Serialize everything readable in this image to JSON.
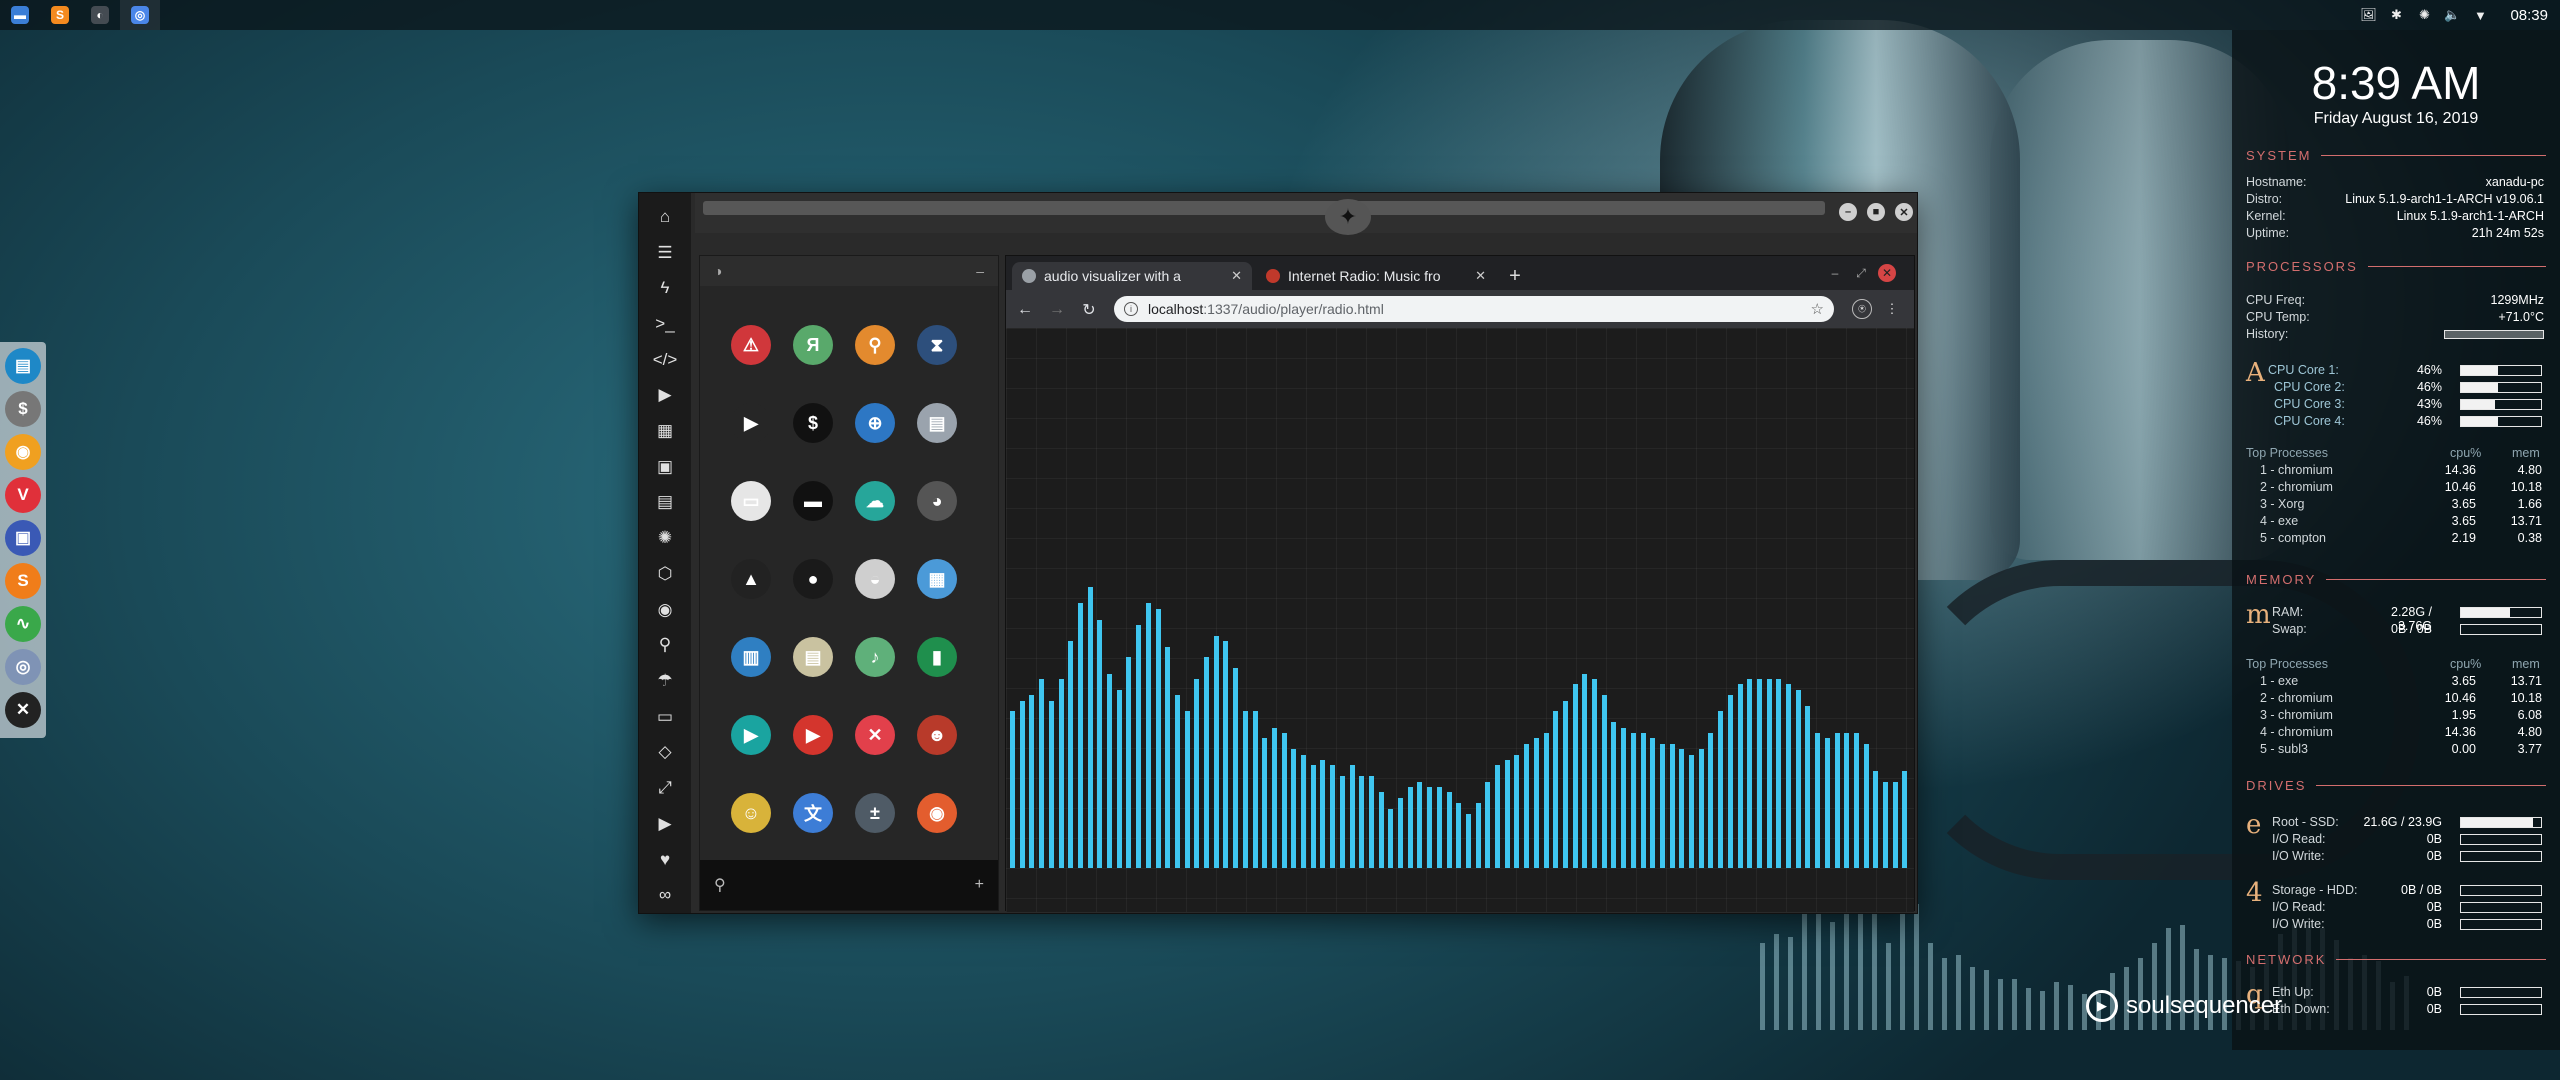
{
  "top_panel": {
    "apps": [
      {
        "name": "file-manager-icon",
        "glyph": "▬",
        "color": "#3b7ed6"
      },
      {
        "name": "sublime-icon",
        "glyph": "S",
        "color": "#f48a1f"
      },
      {
        "name": "moon-icon",
        "glyph": "◐",
        "color": "#444b52"
      },
      {
        "name": "chromium-icon",
        "glyph": "◎",
        "color": "#4a86e8"
      }
    ],
    "tray": [
      "🖼",
      "✱",
      "✺",
      "🔈",
      "▼"
    ],
    "clock": "08:39"
  },
  "dock": [
    {
      "name": "files-dock-icon",
      "glyph": "▤",
      "color": "#1e88c7"
    },
    {
      "name": "money-dock-icon",
      "glyph": "$",
      "color": "#777"
    },
    {
      "name": "ubuntu-dock-icon",
      "glyph": "◉",
      "color": "#f0a020"
    },
    {
      "name": "vivaldi-dock-icon",
      "glyph": "V",
      "color": "#e0303a"
    },
    {
      "name": "screen-dock-icon",
      "glyph": "▣",
      "color": "#3a59b5"
    },
    {
      "name": "sublime-dock-icon",
      "glyph": "S",
      "color": "#f07d1a"
    },
    {
      "name": "monitor-dock-icon",
      "glyph": "∿",
      "color": "#3aa84a"
    },
    {
      "name": "chromium-dock-icon",
      "glyph": "◎",
      "color": "#7f93b5"
    },
    {
      "name": "xbox-dock-icon",
      "glyph": "✕",
      "color": "#222"
    }
  ],
  "rail": [
    "⌂",
    "☰",
    "ϟ",
    ">_",
    "</>",
    "▶",
    "▦",
    "▣",
    "▤",
    "✺",
    "⬡",
    "◉",
    "⚲",
    "☂",
    "▭",
    "◇",
    "⤢",
    "▶",
    "♥",
    "∞"
  ],
  "rail_names": [
    "home-icon",
    "document-icon",
    "bolt-icon",
    "terminal-icon",
    "code-icon",
    "play-icon",
    "box-icon",
    "image-icon",
    "news-icon",
    "gear-icon",
    "hex-icon",
    "globe-icon",
    "search-icon",
    "umbrella-icon",
    "contact-icon",
    "diamond-icon",
    "expand-icon",
    "youtube-icon",
    "heart-icon",
    "infinity-icon"
  ],
  "launcher": {
    "header_icon": "◑",
    "header_action": "–",
    "search_icon": "⚲",
    "add_icon": "+",
    "apps": [
      {
        "name": "warning-app-icon",
        "glyph": "⚠",
        "color": "#d0373b"
      },
      {
        "name": "yandex-app-icon",
        "glyph": "Я",
        "color": "#59a96b"
      },
      {
        "name": "search-app-icon",
        "glyph": "⚲",
        "color": "#e38a2e"
      },
      {
        "name": "hourglass-app-icon",
        "glyph": "⧗",
        "color": "#2d4f7c"
      },
      {
        "name": "sublime-app-icon",
        "glyph": "▶",
        "color": "#262626"
      },
      {
        "name": "terminal-app-icon",
        "glyph": "$",
        "color": "#111"
      },
      {
        "name": "globe-app-icon",
        "glyph": "⊕",
        "color": "#2d77c4"
      },
      {
        "name": "disk-app-icon",
        "glyph": "▤",
        "color": "#9aa3ad"
      },
      {
        "name": "window-app-icon",
        "glyph": "▭",
        "color": "#e6e6e6"
      },
      {
        "name": "drive-app-icon",
        "glyph": "▬",
        "color": "#111"
      },
      {
        "name": "cloud-app-icon",
        "glyph": "☁",
        "color": "#26a69a"
      },
      {
        "name": "github-app-icon",
        "glyph": "◕",
        "color": "#555"
      },
      {
        "name": "startrek-app-icon",
        "glyph": "▲",
        "color": "#222"
      },
      {
        "name": "deathstar-app-icon",
        "glyph": "●",
        "color": "#1a1a1a"
      },
      {
        "name": "moon-app-icon",
        "glyph": "◒",
        "color": "#cfcfcf"
      },
      {
        "name": "maps-app-icon",
        "glyph": "▦",
        "color": "#4b9ad8"
      },
      {
        "name": "books-app-icon",
        "glyph": "▥",
        "color": "#2f7fc2"
      },
      {
        "name": "notes-app-icon",
        "glyph": "▤",
        "color": "#c9c2a0"
      },
      {
        "name": "music-app-icon",
        "glyph": "♪",
        "color": "#5fb07a"
      },
      {
        "name": "film-app-icon",
        "glyph": "▮",
        "color": "#1f8f4d"
      },
      {
        "name": "play-app-icon",
        "glyph": "▶",
        "color": "#1aa4a0"
      },
      {
        "name": "youtube-app-icon",
        "glyph": "▶",
        "color": "#d4352d"
      },
      {
        "name": "close-app-icon",
        "glyph": "✕",
        "color": "#e2404b"
      },
      {
        "name": "ironman-app-icon",
        "glyph": "☻",
        "color": "#b83a2a"
      },
      {
        "name": "c3po-app-icon",
        "glyph": "☺",
        "color": "#d8b33a"
      },
      {
        "name": "translate-app-icon",
        "glyph": "文",
        "color": "#3d7dd6"
      },
      {
        "name": "calculator-app-icon",
        "glyph": "±",
        "color": "#4f5b66"
      },
      {
        "name": "photos-app-icon",
        "glyph": "◉",
        "color": "#e35d2e"
      }
    ]
  },
  "browser": {
    "tab1_title": "audio visualizer with a",
    "tab2_title": "Internet Radio: Music fro",
    "tab_close": "✕",
    "new_tab": "+",
    "url_host": "localhost",
    "url_path": ":1337/audio/player/radio.html",
    "back": "←",
    "forward": "→",
    "reload": "↻",
    "star": "☆",
    "menu": "⋮",
    "ext": "⍟",
    "min": "–",
    "max": "⤢",
    "close": "✕"
  },
  "visualizer": {
    "levels": [
      0.29,
      0.31,
      0.32,
      0.35,
      0.31,
      0.35,
      0.42,
      0.49,
      0.52,
      0.46,
      0.36,
      0.33,
      0.39,
      0.45,
      0.49,
      0.48,
      0.41,
      0.32,
      0.29,
      0.35,
      0.39,
      0.43,
      0.42,
      0.37,
      0.29,
      0.29,
      0.24,
      0.26,
      0.25,
      0.22,
      0.21,
      0.19,
      0.2,
      0.19,
      0.17,
      0.19,
      0.17,
      0.17,
      0.14,
      0.11,
      0.13,
      0.15,
      0.16,
      0.15,
      0.15,
      0.14,
      0.12,
      0.1,
      0.12,
      0.16,
      0.19,
      0.2,
      0.21,
      0.23,
      0.24,
      0.25,
      0.29,
      0.31,
      0.34,
      0.36,
      0.35,
      0.32,
      0.27,
      0.26,
      0.25,
      0.25,
      0.24,
      0.23,
      0.23,
      0.22,
      0.21,
      0.22,
      0.25,
      0.29,
      0.32,
      0.34,
      0.35,
      0.35,
      0.35,
      0.35,
      0.34,
      0.33,
      0.3,
      0.25,
      0.24,
      0.25,
      0.25,
      0.25,
      0.23,
      0.18,
      0.16,
      0.16,
      0.18
    ]
  },
  "conky": {
    "time": "8:39 AM",
    "date": "Friday August 16, 2019",
    "system_head": "SYSTEM",
    "system": [
      {
        "label": "Hostname:",
        "value": "xanadu-pc"
      },
      {
        "label": "Distro:",
        "value": "Linux 5.1.9-arch1-1-ARCH v19.06.1"
      },
      {
        "label": "Kernel:",
        "value": "Linux 5.1.9-arch1-1-ARCH"
      },
      {
        "label": "Uptime:",
        "value": "21h 24m 52s"
      }
    ],
    "proc_head": "PROCESSORS",
    "cpu_freq_label": "CPU Freq:",
    "cpu_freq": "1299MHz",
    "cpu_temp_label": "CPU Temp:",
    "cpu_temp": "+71.0°C",
    "history_label": "History:",
    "cpu_letter": "A",
    "cores": [
      {
        "label": "CPU Core 1:",
        "value": "46%",
        "level": 0.46
      },
      {
        "label": "CPU Core 2:",
        "value": "46%",
        "level": 0.46
      },
      {
        "label": "CPU Core 3:",
        "value": "43%",
        "level": 0.43
      },
      {
        "label": "CPU Core 4:",
        "value": "46%",
        "level": 0.46
      }
    ],
    "top_label": "Top Processes",
    "cpu_col": "cpu%",
    "mem_col": "mem",
    "top_cpu": [
      {
        "name": "1 - chromium",
        "cpu": "14.36",
        "mem": "4.80"
      },
      {
        "name": "2 - chromium",
        "cpu": "10.46",
        "mem": "10.18"
      },
      {
        "name": "3 - Xorg",
        "cpu": "3.65",
        "mem": "1.66"
      },
      {
        "name": "4 - exe",
        "cpu": "3.65",
        "mem": "13.71"
      },
      {
        "name": "5 - compton",
        "cpu": "2.19",
        "mem": "0.38"
      }
    ],
    "mem_head": "MEMORY",
    "mem_letter": "m",
    "ram_label": "RAM:",
    "ram": "2.28G / 3.76G",
    "ram_level": 0.61,
    "swap_label": "Swap:",
    "swap": "0B / 0B",
    "swap_level": 0,
    "top_mem": [
      {
        "name": "1 - exe",
        "cpu": "3.65",
        "mem": "13.71"
      },
      {
        "name": "2 - chromium",
        "cpu": "10.46",
        "mem": "10.18"
      },
      {
        "name": "3 - chromium",
        "cpu": "1.95",
        "mem": "6.08"
      },
      {
        "name": "4 - chromium",
        "cpu": "14.36",
        "mem": "4.80"
      },
      {
        "name": "5 - subl3",
        "cpu": "0.00",
        "mem": "3.77"
      }
    ],
    "drives_head": "DRIVES",
    "drive_letter": "e",
    "drive1_label": "Root - SSD:",
    "drive1": "21.6G / 23.9G",
    "drive1_level": 0.9,
    "io_read_label": "I/O Read:",
    "io_write_label": "I/O Write:",
    "drive1_read": "0B",
    "drive1_write": "0B",
    "drive2_letter": "4",
    "drive2_label": "Storage - HDD:",
    "drive2": "0B / 0B",
    "drive2_level": 0,
    "drive2_read": "0B",
    "drive2_write": "0B",
    "net_head": "NETWORK",
    "net_letter": "q",
    "eth_up_label": "Eth Up:",
    "eth_up": "0B",
    "eth_down_label": "Eth Down:",
    "eth_down": "0B"
  },
  "brand": "soulsequencer"
}
